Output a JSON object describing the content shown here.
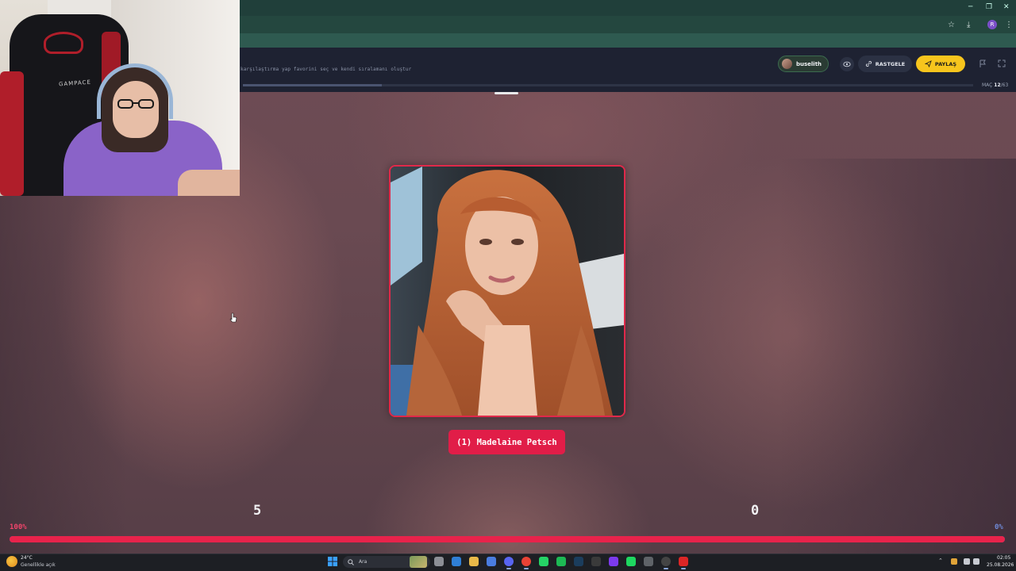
{
  "browser": {
    "window_controls": [
      "─",
      "❐",
      "✕"
    ],
    "toolbar_icons": [
      "star-icon",
      "download-icon",
      "profile-avatar",
      "menu-icon"
    ],
    "profile_initial": "R"
  },
  "app": {
    "subtitle": "karşılaştırma yap favorini seç ve kendi sıralamanı oluştur",
    "match_prefix": "MAÇ",
    "match_current": "12",
    "match_total": "/63",
    "match_progress": 0.19,
    "user_name": "buselith",
    "random_label": "RASTGELE",
    "share_label": "PAYLAŞ",
    "colors": {
      "accent_red": "#e11d48",
      "share_yellow": "#f7c51d",
      "bar_blue": "#5a6fb8"
    }
  },
  "matchup": {
    "contestant_label": "(1) Madelaine Petsch",
    "score_left": "5",
    "score_right": "0",
    "pct_left_label": "100%",
    "pct_right_label": "0%",
    "left_share": 1.0
  },
  "webcam": {
    "chair_text": "GAMPACE"
  },
  "taskbar": {
    "weather_temp": "24°C",
    "weather_desc": "Genellikle açık",
    "search_placeholder": "Ara",
    "apps": [
      "file-explorer",
      "edge",
      "folder",
      "store",
      "discord",
      "chrome",
      "whatsapp",
      "xbox",
      "steam",
      "epic-games",
      "purple-app",
      "spotify",
      "g-app",
      "obs",
      "red-app"
    ],
    "clock_time": "02:05",
    "clock_date": "25.08.2026"
  }
}
